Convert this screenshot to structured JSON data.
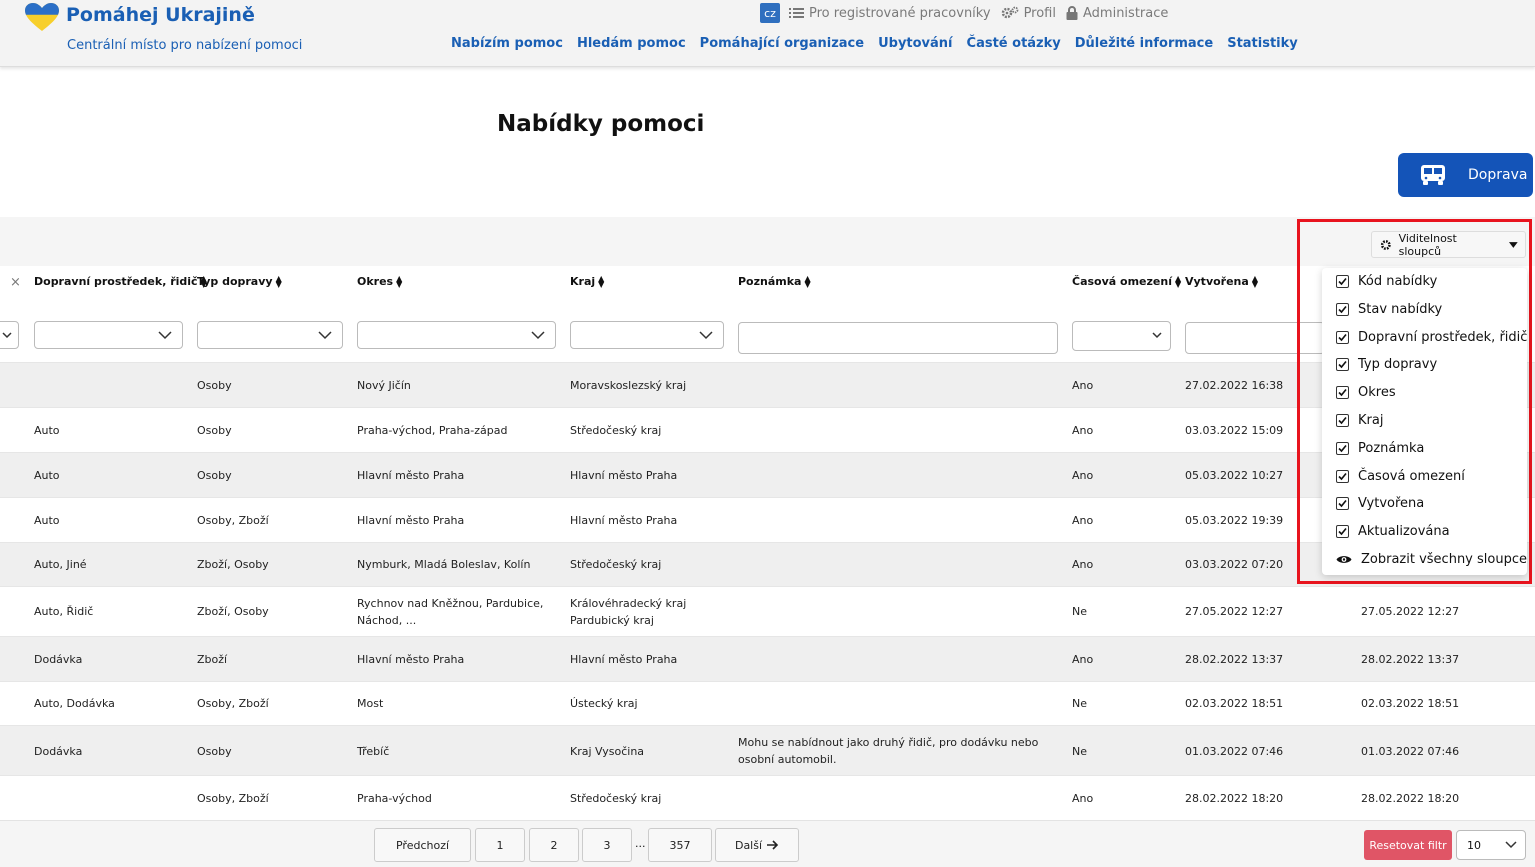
{
  "header": {
    "logo_title": "Pomáhej Ukrajině",
    "logo_subtitle": "Centrální místo pro nabízení pomoci",
    "lang": "cz",
    "top_links": [
      "Pro registrované pracovníky",
      "Profil",
      "Administrace"
    ],
    "nav": [
      "Nabízím pomoc",
      "Hledám pomoc",
      "Pomáhající organizace",
      "Ubytování",
      "Časté otázky",
      "Důležité informace",
      "Statistiky"
    ]
  },
  "page": {
    "title": "Nabídky pomoci",
    "doprava_button": "Doprava"
  },
  "table": {
    "clear_icon": "×",
    "columns": [
      "Dopravní prostředek, řidič",
      "Typ dopravy",
      "Okres",
      "Kraj",
      "Poznámka",
      "Časová omezení",
      "Vytvořena"
    ],
    "rows": [
      {
        "vehicle": "",
        "type": "Osoby",
        "okres": "Nový Jičín",
        "kraj": "Moravskoslezský kraj",
        "kraj2": "",
        "okres2": "",
        "note": "",
        "note2": "",
        "limit": "Ano",
        "created": "27.02.2022 16:38",
        "updated": ""
      },
      {
        "vehicle": "Auto",
        "type": "Osoby",
        "okres": "Praha-východ, Praha-západ",
        "kraj": "Středočeský kraj",
        "kraj2": "",
        "okres2": "",
        "note": "",
        "note2": "",
        "limit": "Ano",
        "created": "03.03.2022 15:09",
        "updated": ""
      },
      {
        "vehicle": "Auto",
        "type": "Osoby",
        "okres": "Hlavní město Praha",
        "kraj": "Hlavní město Praha",
        "kraj2": "",
        "okres2": "",
        "note": "",
        "note2": "",
        "limit": "Ano",
        "created": "05.03.2022 10:27",
        "updated": ""
      },
      {
        "vehicle": "Auto",
        "type": "Osoby, Zboží",
        "okres": "Hlavní město Praha",
        "kraj": "Hlavní město Praha",
        "kraj2": "",
        "okres2": "",
        "note": "",
        "note2": "",
        "limit": "Ano",
        "created": "05.03.2022 19:39",
        "updated": ""
      },
      {
        "vehicle": "Auto, Jiné",
        "type": "Zboží, Osoby",
        "okres": "Nymburk, Mladá Boleslav, Kolín",
        "kraj": "Středočeský kraj",
        "kraj2": "",
        "okres2": "",
        "note": "",
        "note2": "",
        "limit": "Ano",
        "created": "03.03.2022 07:20",
        "updated": ""
      },
      {
        "vehicle": "Auto, Řidič",
        "type": "Zboží, Osoby",
        "okres": "Rychnov nad Kněžnou, Pardubice,",
        "okres2": "Náchod, ...",
        "kraj": "Královéhradecký kraj",
        "kraj2": "Pardubický kraj",
        "note": "",
        "note2": "",
        "limit": "Ne",
        "created": "27.05.2022 12:27",
        "updated": "27.05.2022 12:27"
      },
      {
        "vehicle": "Dodávka",
        "type": "Zboží",
        "okres": "Hlavní město Praha",
        "kraj": "Hlavní město Praha",
        "kraj2": "",
        "okres2": "",
        "note": "",
        "note2": "",
        "limit": "Ano",
        "created": "28.02.2022 13:37",
        "updated": "28.02.2022 13:37"
      },
      {
        "vehicle": "Auto, Dodávka",
        "type": "Osoby, Zboží",
        "okres": "Most",
        "kraj": "Ústecký kraj",
        "kraj2": "",
        "okres2": "",
        "note": "",
        "note2": "",
        "limit": "Ne",
        "created": "02.03.2022 18:51",
        "updated": "02.03.2022 18:51"
      },
      {
        "vehicle": "Dodávka",
        "type": "Osoby",
        "okres": "Třebíč",
        "kraj": "Kraj Vysočina",
        "kraj2": "",
        "okres2": "",
        "note": "Mohu se nabídnout jako druhý řidič, pro dodávku nebo",
        "note2": "osobní automobil.",
        "limit": "Ne",
        "created": "01.03.2022 07:46",
        "updated": "01.03.2022 07:46"
      },
      {
        "vehicle": "",
        "type": "Osoby, Zboží",
        "okres": "Praha-východ",
        "kraj": "Středočeský kraj",
        "kraj2": "",
        "okres2": "",
        "note": "",
        "note2": "",
        "limit": "Ano",
        "created": "28.02.2022 18:20",
        "updated": "28.02.2022 18:20"
      }
    ]
  },
  "pagination": {
    "prev": "Předchozí",
    "pages": [
      "1",
      "2",
      "3"
    ],
    "ellipsis": "...",
    "last": "357",
    "next": "Další",
    "reset": "Resetovat filtr",
    "page_size": "10"
  },
  "column_visibility": {
    "button_label": "Viditelnost sloupců",
    "items": [
      "Kód nabídky",
      "Stav nabídky",
      "Dopravní prostředek, řidič",
      "Typ dopravy",
      "Okres",
      "Kraj",
      "Poznámka",
      "Časová omezení",
      "Vytvořena",
      "Aktualizována"
    ],
    "show_all": "Zobrazit všechny sloupce"
  },
  "colors": {
    "brand_blue": "#1a5fb4",
    "button_blue": "#1454b8",
    "reset_red": "#e05566",
    "highlight_red": "#e8141e"
  }
}
